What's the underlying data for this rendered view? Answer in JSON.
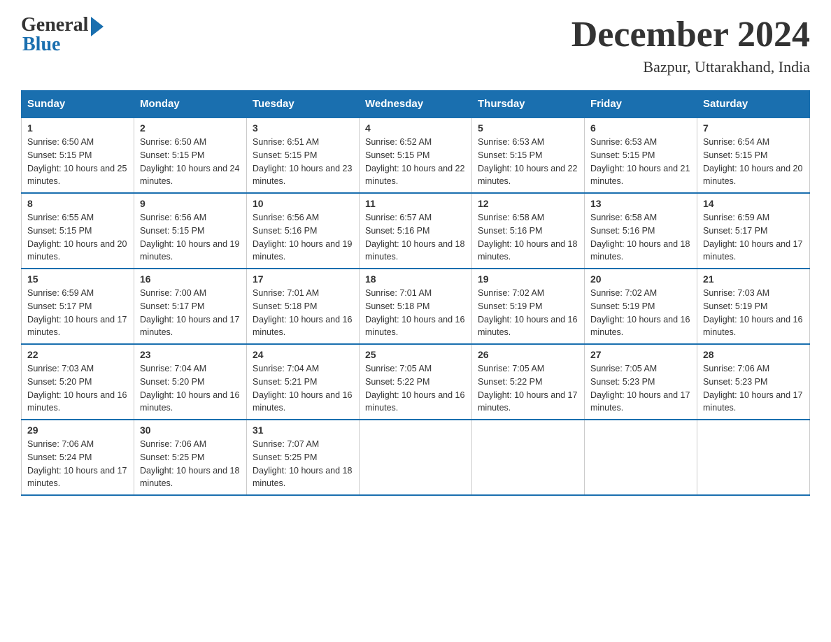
{
  "logo": {
    "general": "General",
    "blue": "Blue"
  },
  "title": "December 2024",
  "location": "Bazpur, Uttarakhand, India",
  "days_header": [
    "Sunday",
    "Monday",
    "Tuesday",
    "Wednesday",
    "Thursday",
    "Friday",
    "Saturday"
  ],
  "weeks": [
    [
      {
        "day": "1",
        "sunrise": "6:50 AM",
        "sunset": "5:15 PM",
        "daylight": "10 hours and 25 minutes."
      },
      {
        "day": "2",
        "sunrise": "6:50 AM",
        "sunset": "5:15 PM",
        "daylight": "10 hours and 24 minutes."
      },
      {
        "day": "3",
        "sunrise": "6:51 AM",
        "sunset": "5:15 PM",
        "daylight": "10 hours and 23 minutes."
      },
      {
        "day": "4",
        "sunrise": "6:52 AM",
        "sunset": "5:15 PM",
        "daylight": "10 hours and 22 minutes."
      },
      {
        "day": "5",
        "sunrise": "6:53 AM",
        "sunset": "5:15 PM",
        "daylight": "10 hours and 22 minutes."
      },
      {
        "day": "6",
        "sunrise": "6:53 AM",
        "sunset": "5:15 PM",
        "daylight": "10 hours and 21 minutes."
      },
      {
        "day": "7",
        "sunrise": "6:54 AM",
        "sunset": "5:15 PM",
        "daylight": "10 hours and 20 minutes."
      }
    ],
    [
      {
        "day": "8",
        "sunrise": "6:55 AM",
        "sunset": "5:15 PM",
        "daylight": "10 hours and 20 minutes."
      },
      {
        "day": "9",
        "sunrise": "6:56 AM",
        "sunset": "5:15 PM",
        "daylight": "10 hours and 19 minutes."
      },
      {
        "day": "10",
        "sunrise": "6:56 AM",
        "sunset": "5:16 PM",
        "daylight": "10 hours and 19 minutes."
      },
      {
        "day": "11",
        "sunrise": "6:57 AM",
        "sunset": "5:16 PM",
        "daylight": "10 hours and 18 minutes."
      },
      {
        "day": "12",
        "sunrise": "6:58 AM",
        "sunset": "5:16 PM",
        "daylight": "10 hours and 18 minutes."
      },
      {
        "day": "13",
        "sunrise": "6:58 AM",
        "sunset": "5:16 PM",
        "daylight": "10 hours and 18 minutes."
      },
      {
        "day": "14",
        "sunrise": "6:59 AM",
        "sunset": "5:17 PM",
        "daylight": "10 hours and 17 minutes."
      }
    ],
    [
      {
        "day": "15",
        "sunrise": "6:59 AM",
        "sunset": "5:17 PM",
        "daylight": "10 hours and 17 minutes."
      },
      {
        "day": "16",
        "sunrise": "7:00 AM",
        "sunset": "5:17 PM",
        "daylight": "10 hours and 17 minutes."
      },
      {
        "day": "17",
        "sunrise": "7:01 AM",
        "sunset": "5:18 PM",
        "daylight": "10 hours and 16 minutes."
      },
      {
        "day": "18",
        "sunrise": "7:01 AM",
        "sunset": "5:18 PM",
        "daylight": "10 hours and 16 minutes."
      },
      {
        "day": "19",
        "sunrise": "7:02 AM",
        "sunset": "5:19 PM",
        "daylight": "10 hours and 16 minutes."
      },
      {
        "day": "20",
        "sunrise": "7:02 AM",
        "sunset": "5:19 PM",
        "daylight": "10 hours and 16 minutes."
      },
      {
        "day": "21",
        "sunrise": "7:03 AM",
        "sunset": "5:19 PM",
        "daylight": "10 hours and 16 minutes."
      }
    ],
    [
      {
        "day": "22",
        "sunrise": "7:03 AM",
        "sunset": "5:20 PM",
        "daylight": "10 hours and 16 minutes."
      },
      {
        "day": "23",
        "sunrise": "7:04 AM",
        "sunset": "5:20 PM",
        "daylight": "10 hours and 16 minutes."
      },
      {
        "day": "24",
        "sunrise": "7:04 AM",
        "sunset": "5:21 PM",
        "daylight": "10 hours and 16 minutes."
      },
      {
        "day": "25",
        "sunrise": "7:05 AM",
        "sunset": "5:22 PM",
        "daylight": "10 hours and 16 minutes."
      },
      {
        "day": "26",
        "sunrise": "7:05 AM",
        "sunset": "5:22 PM",
        "daylight": "10 hours and 17 minutes."
      },
      {
        "day": "27",
        "sunrise": "7:05 AM",
        "sunset": "5:23 PM",
        "daylight": "10 hours and 17 minutes."
      },
      {
        "day": "28",
        "sunrise": "7:06 AM",
        "sunset": "5:23 PM",
        "daylight": "10 hours and 17 minutes."
      }
    ],
    [
      {
        "day": "29",
        "sunrise": "7:06 AM",
        "sunset": "5:24 PM",
        "daylight": "10 hours and 17 minutes."
      },
      {
        "day": "30",
        "sunrise": "7:06 AM",
        "sunset": "5:25 PM",
        "daylight": "10 hours and 18 minutes."
      },
      {
        "day": "31",
        "sunrise": "7:07 AM",
        "sunset": "5:25 PM",
        "daylight": "10 hours and 18 minutes."
      },
      null,
      null,
      null,
      null
    ]
  ]
}
